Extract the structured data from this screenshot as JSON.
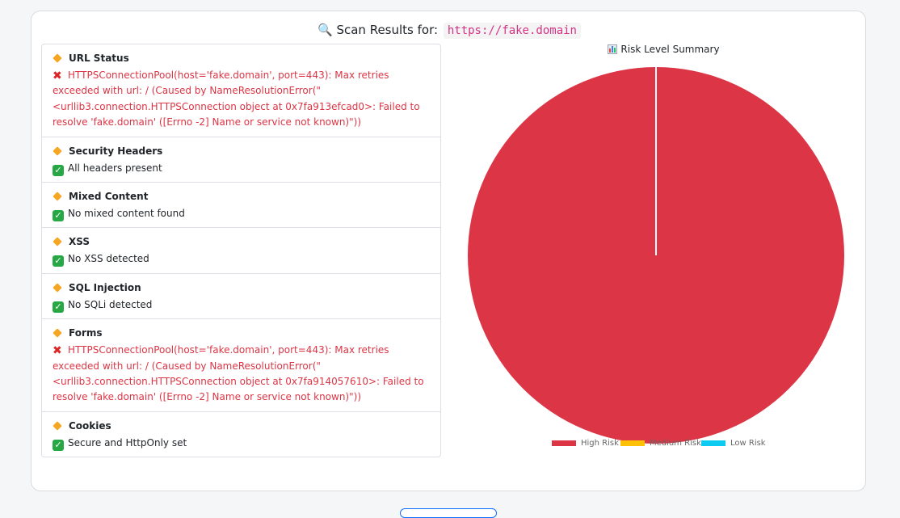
{
  "header": {
    "label": "Scan Results for:",
    "url": "https://fake.domain"
  },
  "results": [
    {
      "title": "URL Status",
      "status": "error",
      "message": "HTTPSConnectionPool(host='fake.domain', port=443): Max retries exceeded with url: / (Caused by NameResolutionError(\"<urllib3.connection.HTTPSConnection object at 0x7fa913efcad0>: Failed to resolve 'fake.domain' ([Errno -2] Name or service not known)\"))"
    },
    {
      "title": "Security Headers",
      "status": "ok",
      "message": "All headers present"
    },
    {
      "title": "Mixed Content",
      "status": "ok",
      "message": "No mixed content found"
    },
    {
      "title": "XSS",
      "status": "ok",
      "message": "No XSS detected"
    },
    {
      "title": "SQL Injection",
      "status": "ok",
      "message": "No SQLi detected"
    },
    {
      "title": "Forms",
      "status": "error",
      "message": "HTTPSConnectionPool(host='fake.domain', port=443): Max retries exceeded with url: / (Caused by NameResolutionError(\"<urllib3.connection.HTTPSConnection object at 0x7fa914057610>: Failed to resolve 'fake.domain' ([Errno -2] Name or service not known)\"))"
    },
    {
      "title": "Cookies",
      "status": "ok",
      "message": "Secure and HttpOnly set"
    }
  ],
  "chart_data": {
    "type": "pie",
    "title": "Risk Level Summary",
    "categories": [
      "High Risk",
      "Medium Risk",
      "Low Risk"
    ],
    "values": [
      1,
      0,
      0
    ],
    "colors": [
      "#dc3545",
      "#ffc107",
      "#0dcaf0"
    ],
    "legend_position": "bottom"
  }
}
